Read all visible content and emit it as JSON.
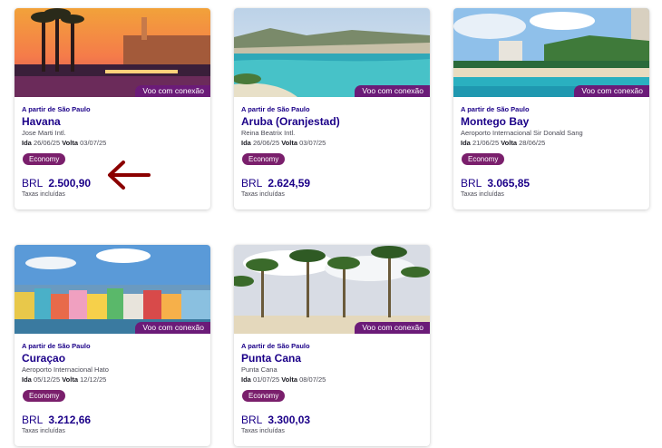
{
  "cards": [
    {
      "badge": "Voo com conexão",
      "from": "A partir de São Paulo",
      "destination": "Havana",
      "airport": "Jose Marti Intl.",
      "ida_label": "Ida",
      "ida_date": "26/06/25",
      "volta_label": "Volta",
      "volta_date": "03/07/25",
      "cabin": "Economy",
      "currency": "BRL",
      "price": "2.500,90",
      "taxes": "Taxas incluídas"
    },
    {
      "badge": "Voo com conexão",
      "from": "A partir de São Paulo",
      "destination": "Aruba (Oranjestad)",
      "airport": "Reina Beatrix Intl.",
      "ida_label": "Ida",
      "ida_date": "26/06/25",
      "volta_label": "Volta",
      "volta_date": "03/07/25",
      "cabin": "Economy",
      "currency": "BRL",
      "price": "2.624,59",
      "taxes": "Taxas incluídas"
    },
    {
      "badge": "Voo com conexão",
      "from": "A partir de São Paulo",
      "destination": "Montego Bay",
      "airport": "Aeroporto Internacional Sir Donald Sang",
      "ida_label": "Ida",
      "ida_date": "21/06/25",
      "volta_label": "Volta",
      "volta_date": "28/06/25",
      "cabin": "Economy",
      "currency": "BRL",
      "price": "3.065,85",
      "taxes": "Taxas incluídas"
    },
    {
      "badge": "Voo com conexão",
      "from": "A partir de São Paulo",
      "destination": "Curaçao",
      "airport": "Aeroporto Internacional Hato",
      "ida_label": "Ida",
      "ida_date": "05/12/25",
      "volta_label": "Volta",
      "volta_date": "12/12/25",
      "cabin": "Economy",
      "currency": "BRL",
      "price": "3.212,66",
      "taxes": "Taxas incluídas"
    },
    {
      "badge": "Voo com conexão",
      "from": "A partir de São Paulo",
      "destination": "Punta Cana",
      "airport": "Punta Cana",
      "ida_label": "Ida",
      "ida_date": "01/07/25",
      "volta_label": "Volta",
      "volta_date": "08/07/25",
      "cabin": "Economy",
      "currency": "BRL",
      "price": "3.300,03",
      "taxes": "Taxas incluídas"
    }
  ],
  "colors": {
    "brand": "#1b0088",
    "badge": "#6b1b78",
    "pill": "#7a1f6c",
    "arrow": "#8b0000"
  },
  "icons": {
    "annotation": "left-arrow-icon"
  }
}
